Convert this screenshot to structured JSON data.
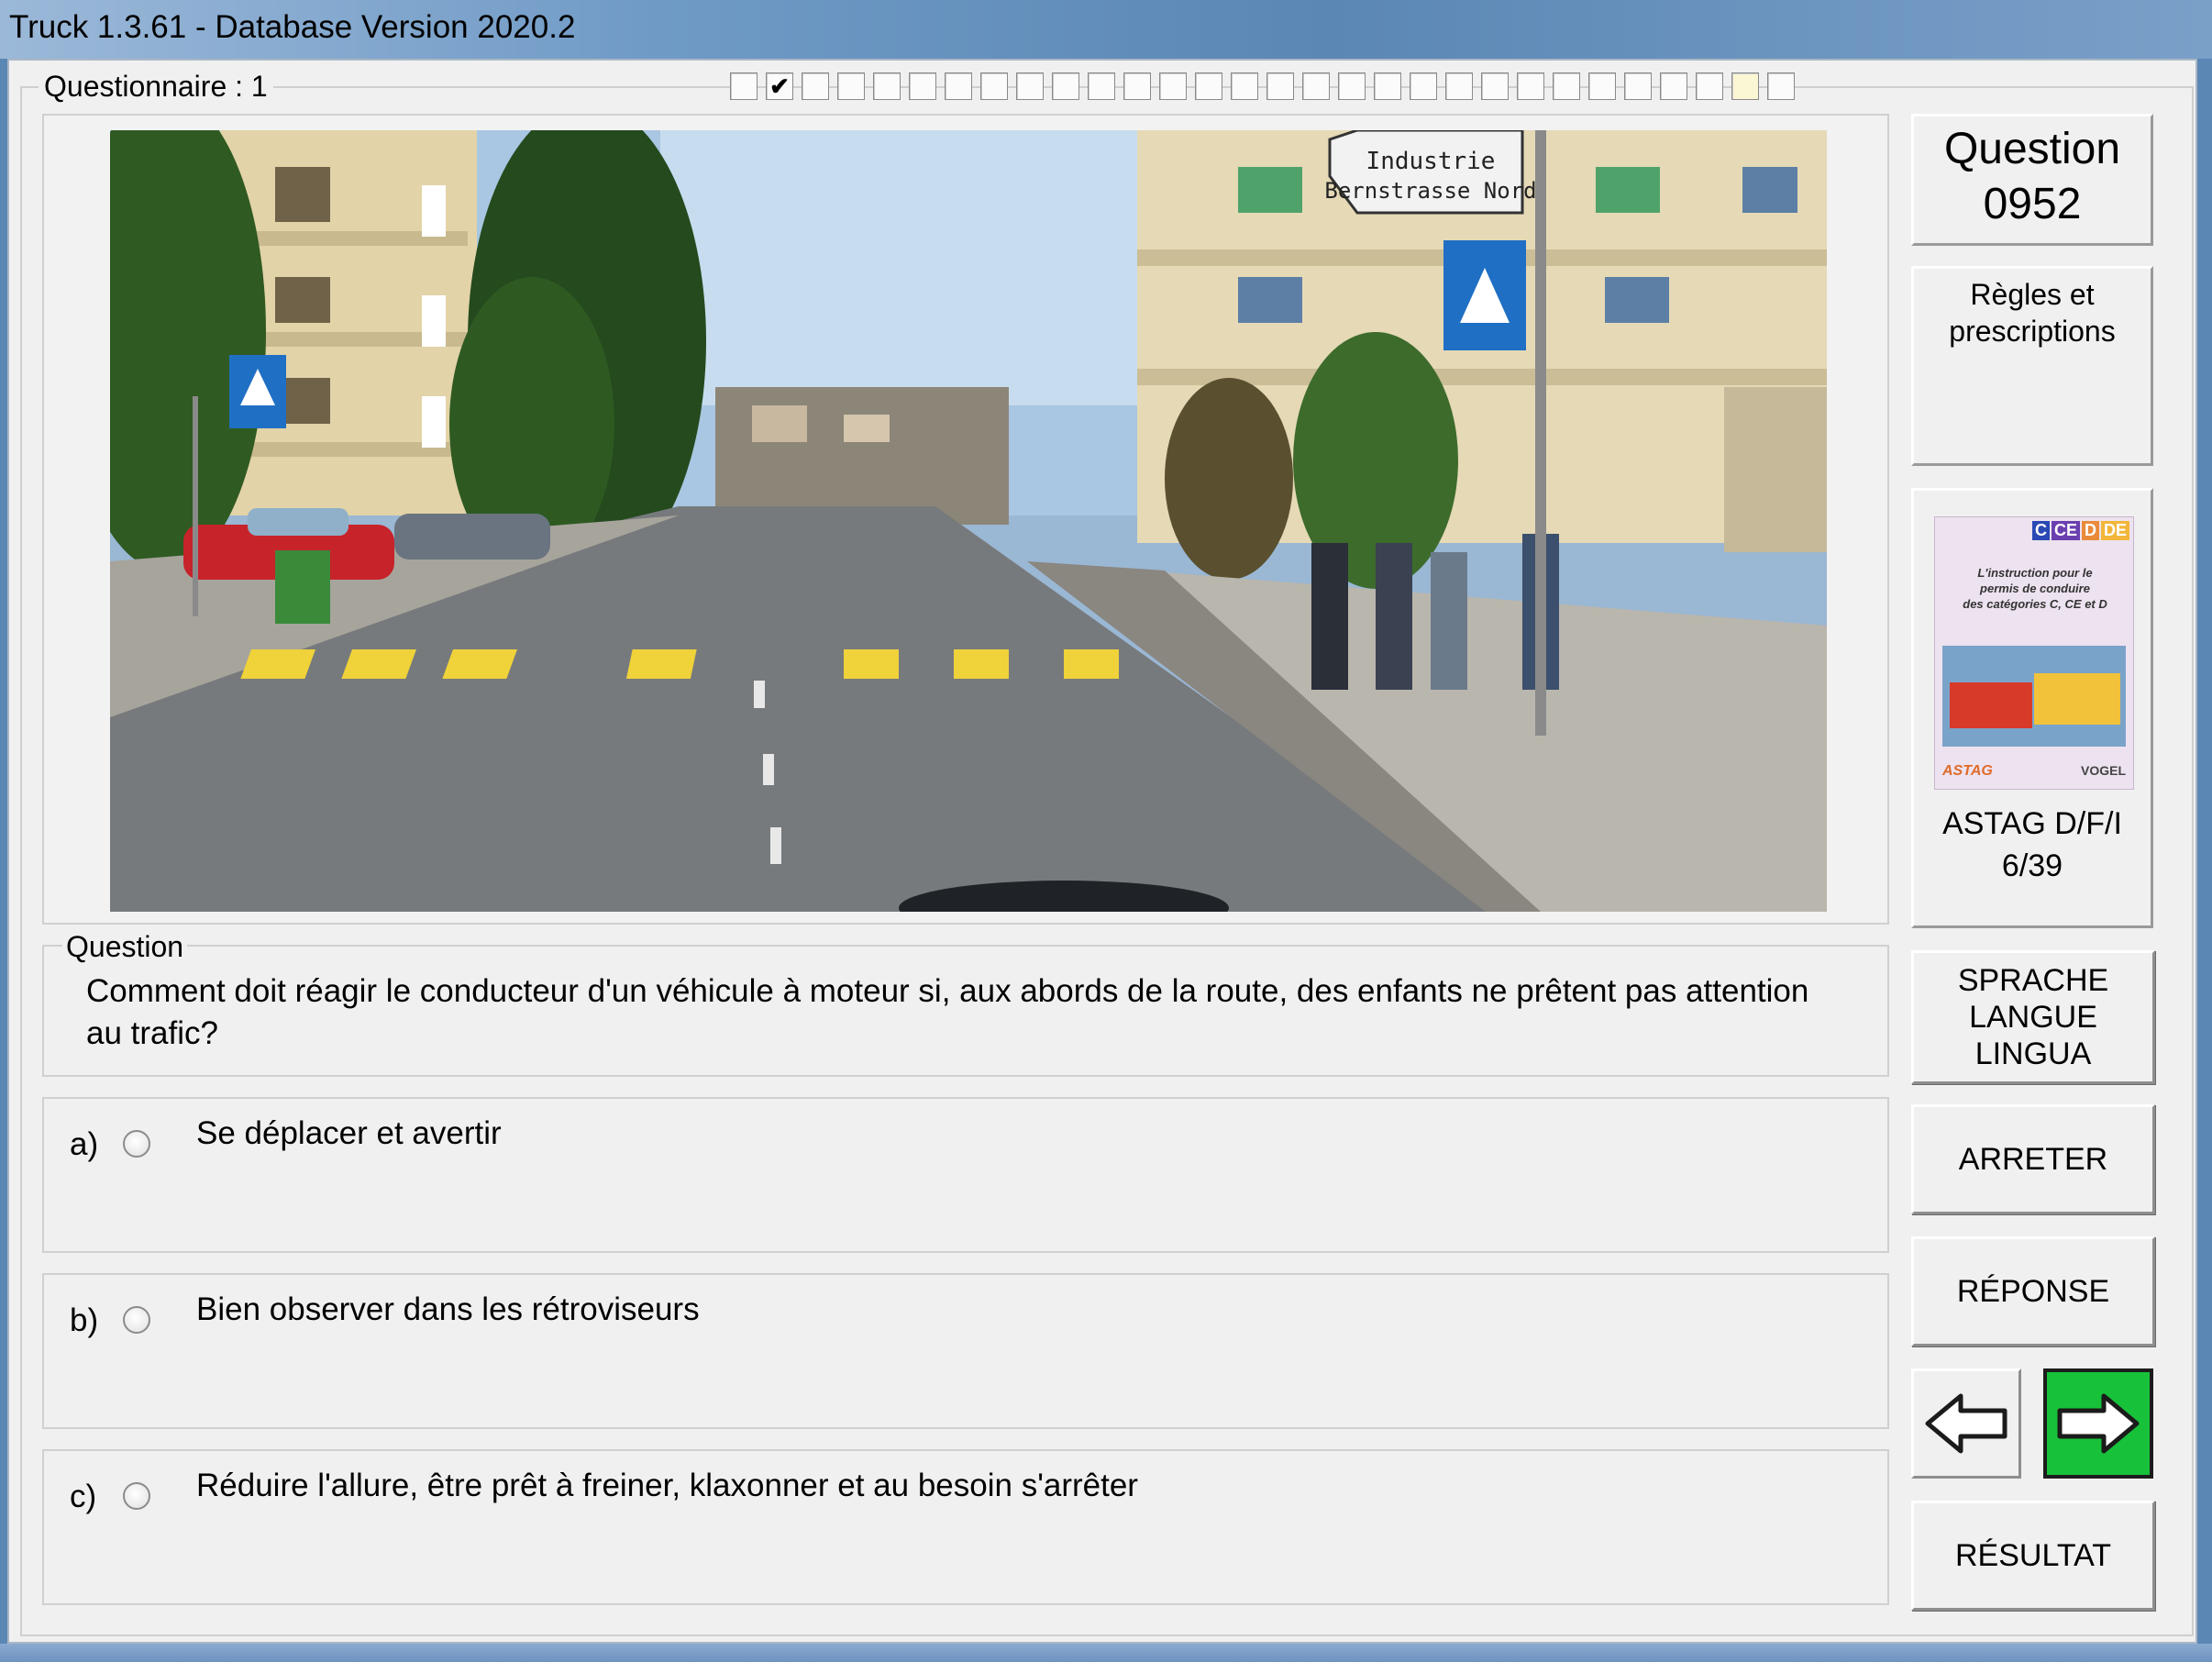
{
  "window": {
    "title": "Truck 1.3.61 - Database Version 2020.2"
  },
  "questionnaire": {
    "label": "Questionnaire : 1",
    "progress": {
      "count": 30,
      "checked": [
        1
      ],
      "highlighted": [
        28
      ]
    }
  },
  "question_number": {
    "line1": "Question",
    "line2": "0952"
  },
  "category": {
    "line1": "Règles et",
    "line2": "prescriptions"
  },
  "source": {
    "cover_badges": [
      "C",
      "CE",
      "D",
      "DE"
    ],
    "cover_text": [
      "L'instruction pour le",
      "permis de conduire",
      "des catégories C, CE et D"
    ],
    "cover_logo_left": "ASTAG",
    "cover_logo_right": "VOGEL",
    "line1": "ASTAG D/F/I",
    "line2": "6/39"
  },
  "photo": {
    "sign_line1": "Industrie",
    "sign_line2": "Bernstrasse Nord"
  },
  "question": {
    "legend": "Question",
    "text": "Comment doit réagir le conducteur d'un véhicule à moteur si, aux abords de la route, des enfants ne prêtent pas attention au trafic?"
  },
  "answers": [
    {
      "letter": "a)",
      "text": "Se déplacer et avertir",
      "selected": false
    },
    {
      "letter": "b)",
      "text": "Bien observer dans les rétroviseurs",
      "selected": false
    },
    {
      "letter": "c)",
      "text": "Réduire l'allure, être prêt à freiner, klaxonner et au besoin s'arrêter",
      "selected": false
    }
  ],
  "buttons": {
    "language": [
      "SPRACHE",
      "LANGUE",
      "LINGUA"
    ],
    "stop": "ARRETER",
    "response": "RÉPONSE",
    "result": "RÉSULTAT",
    "prev_icon": "arrow-left-icon",
    "next_icon": "arrow-right-icon"
  },
  "colors": {
    "next_button": "#17c13a",
    "crosswalk": "#f0d23a",
    "sign_blue": "#1f6fc4"
  }
}
